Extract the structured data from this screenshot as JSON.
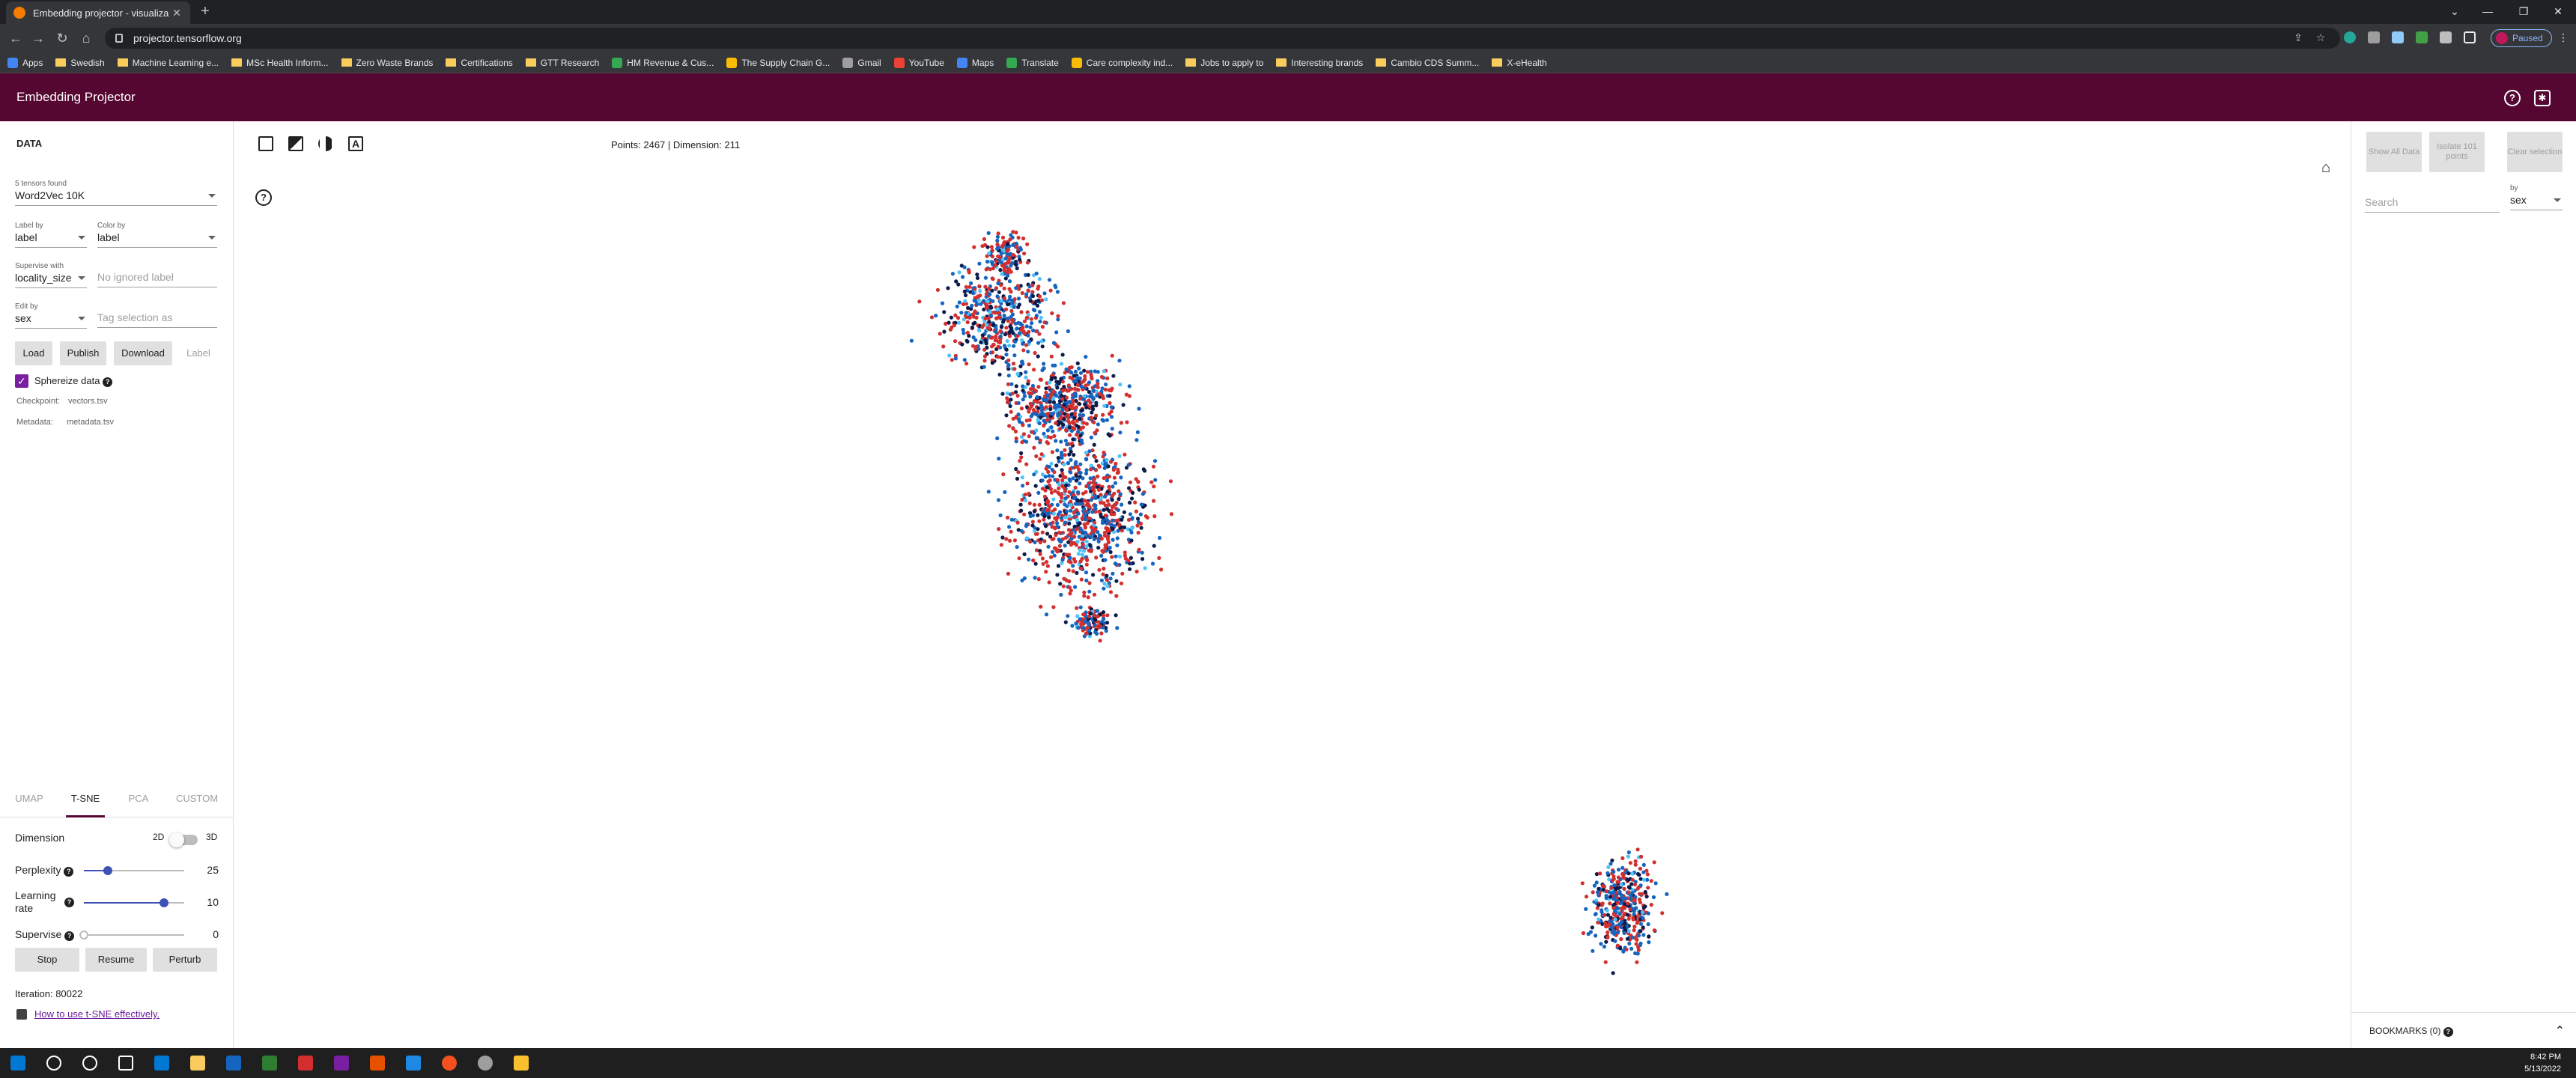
{
  "browser": {
    "tab_title": "Embedding projector - visualiza",
    "url": "projector.tensorflow.org",
    "profile_label": "Paused",
    "bookmarks": [
      {
        "label": "Apps",
        "kind": "apps"
      },
      {
        "label": "Swedish",
        "kind": "folder"
      },
      {
        "label": "Machine Learning e...",
        "kind": "folder"
      },
      {
        "label": "MSc Health Inform...",
        "kind": "folder"
      },
      {
        "label": "Zero Waste Brands",
        "kind": "folder"
      },
      {
        "label": "Certifications",
        "kind": "folder"
      },
      {
        "label": "GTT Research",
        "kind": "folder"
      },
      {
        "label": "HM Revenue & Cus...",
        "kind": "site"
      },
      {
        "label": "The Supply Chain G...",
        "kind": "site"
      },
      {
        "label": "Gmail",
        "kind": "site"
      },
      {
        "label": "YouTube",
        "kind": "site"
      },
      {
        "label": "Maps",
        "kind": "site"
      },
      {
        "label": "Translate",
        "kind": "site"
      },
      {
        "label": "Care complexity ind...",
        "kind": "site"
      },
      {
        "label": "Jobs to apply to",
        "kind": "folder"
      },
      {
        "label": "Interesting brands",
        "kind": "folder"
      },
      {
        "label": "Cambio CDS Summ...",
        "kind": "folder"
      },
      {
        "label": "X-eHealth",
        "kind": "folder"
      }
    ]
  },
  "app": {
    "title": "Embedding Projector"
  },
  "data_panel": {
    "heading": "DATA",
    "tensors_caption": "5 tensors found",
    "tensor_value": "Word2Vec 10K",
    "label_by_caption": "Label by",
    "label_by_value": "label",
    "color_by_caption": "Color by",
    "color_by_value": "label",
    "supervise_caption": "Supervise with",
    "supervise_value": "locality_size",
    "ignored_placeholder": "No ignored label",
    "edit_by_caption": "Edit by",
    "edit_by_value": "sex",
    "tag_placeholder": "Tag selection as",
    "load_label": "Load",
    "publish_label": "Publish",
    "download_label": "Download",
    "label_button": "Label",
    "sphereize_label": "Sphereize data",
    "checkpoint_label": "Checkpoint:",
    "checkpoint_value": "vectors.tsv",
    "metadata_label": "Metadata:",
    "metadata_value": "metadata.tsv"
  },
  "method_tabs": [
    "UMAP",
    "T-SNE",
    "PCA",
    "CUSTOM"
  ],
  "tsne": {
    "dimension_label": "Dimension",
    "dim_2d": "2D",
    "dim_3d": "3D",
    "perplexity_label": "Perplexity",
    "perplexity_value": "25",
    "perplexity_fraction": 0.24,
    "learning_rate_label_1": "Learning",
    "learning_rate_label_2": "rate",
    "learning_rate_value": "10",
    "learning_rate_fraction": 0.8,
    "supervise_label": "Supervise",
    "supervise_value": "0",
    "supervise_fraction": 0.0,
    "stop_label": "Stop",
    "resume_label": "Resume",
    "perturb_label": "Perturb",
    "iteration_text": "Iteration: 80022",
    "help_link": "How to use t-SNE effectively."
  },
  "center": {
    "stats_text": "Points: 2467 | Dimension: 211",
    "points_total": 2467
  },
  "right_panel": {
    "show_all_label": "Show All Data",
    "isolate_label": "Isolate 101 points",
    "clear_label": "Clear selection",
    "search_placeholder": "Search",
    "by_caption": "by",
    "by_value": "sex",
    "bookmarks_label": "BOOKMARKS (0)"
  },
  "taskbar": {
    "time": "8:42 PM",
    "date": "5/13/2022"
  },
  "colors": {
    "brand": "#560731",
    "point_red": "#d32f2f",
    "point_blue": "#1565c0",
    "point_navy": "#0d1b4a",
    "point_light": "#4fc3f7"
  }
}
